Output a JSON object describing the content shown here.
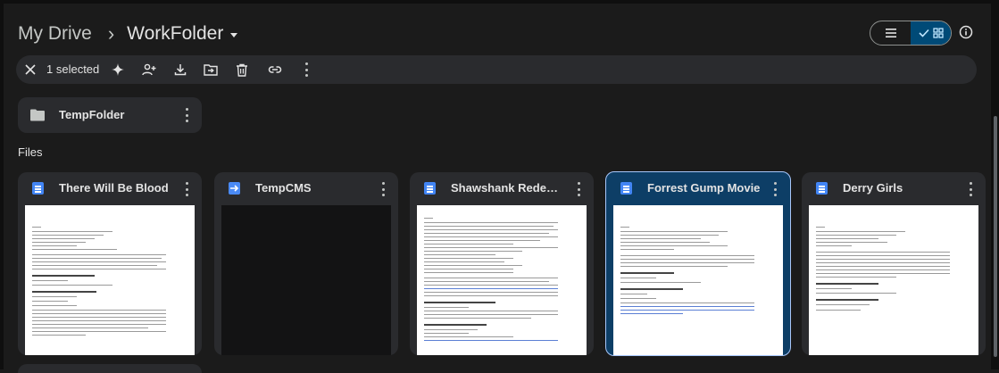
{
  "breadcrumb": {
    "root": "My Drive",
    "separator": "›",
    "current": "WorkFolder"
  },
  "selection": {
    "label": "1 selected"
  },
  "folders": [
    {
      "name": "TempFolder"
    }
  ],
  "files_section": {
    "label": "Files"
  },
  "files": [
    {
      "name": "There Will Be Blood",
      "type": "doc",
      "selected": false
    },
    {
      "name": "TempCMS",
      "type": "arrow",
      "selected": false
    },
    {
      "name": "Shawshank Redemption",
      "type": "doc",
      "selected": false
    },
    {
      "name": "Forrest Gump Movie",
      "type": "doc",
      "selected": true
    },
    {
      "name": "Derry Girls",
      "type": "doc",
      "selected": false
    }
  ],
  "colors": {
    "background": "#1b1b1b",
    "card": "#2a2b2e",
    "selected_card": "#0d3e66",
    "accent": "#a8c7fa"
  }
}
